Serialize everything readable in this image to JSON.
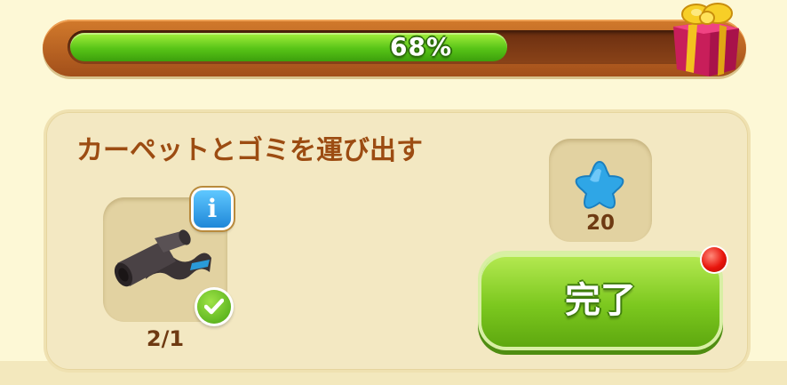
{
  "progress": {
    "percent_label": "68%",
    "value": 0.68
  },
  "gift": {
    "icon": "gift-box-icon"
  },
  "quest": {
    "title": "カーペットとゴミを運び出す",
    "item": {
      "icon": "carpet-roll-icon",
      "count_label": "2/1",
      "info_icon": "info-icon",
      "info_label": "i",
      "status_icon": "checkmark-icon"
    },
    "reward": {
      "icon": "blue-star-icon",
      "amount": "20"
    },
    "complete_button": {
      "label": "完了",
      "notification": true
    }
  },
  "colors": {
    "progress_fill": "#58c417",
    "frame": "#a24f1a",
    "title_text": "#9c4c12",
    "button_green": "#7cc81f",
    "notification_red": "#e8150c",
    "star_blue": "#2fa6e6"
  }
}
